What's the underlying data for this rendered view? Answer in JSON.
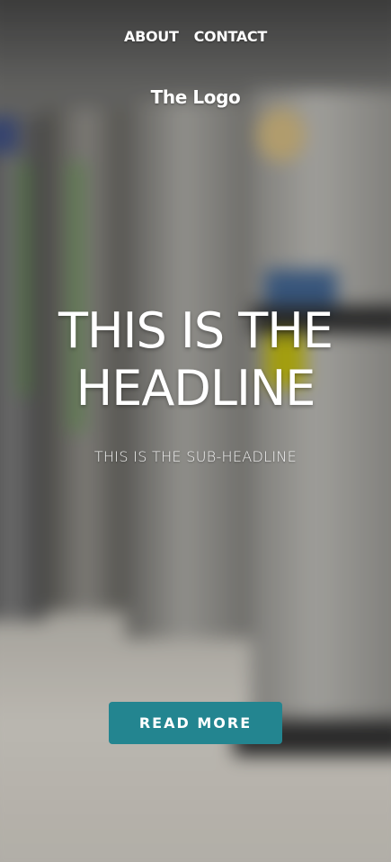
{
  "nav": {
    "items": [
      {
        "label": "ABOUT"
      },
      {
        "label": "CONTACT"
      }
    ]
  },
  "logo": "The Logo",
  "hero": {
    "headline_line1": "THIS IS THE",
    "headline_line2": "HEADLINE",
    "subheadline": "THIS IS THE SUB-HEADLINE",
    "cta_label": "READ MORE"
  },
  "colors": {
    "cta_background": "#238590",
    "text": "#ffffff"
  }
}
